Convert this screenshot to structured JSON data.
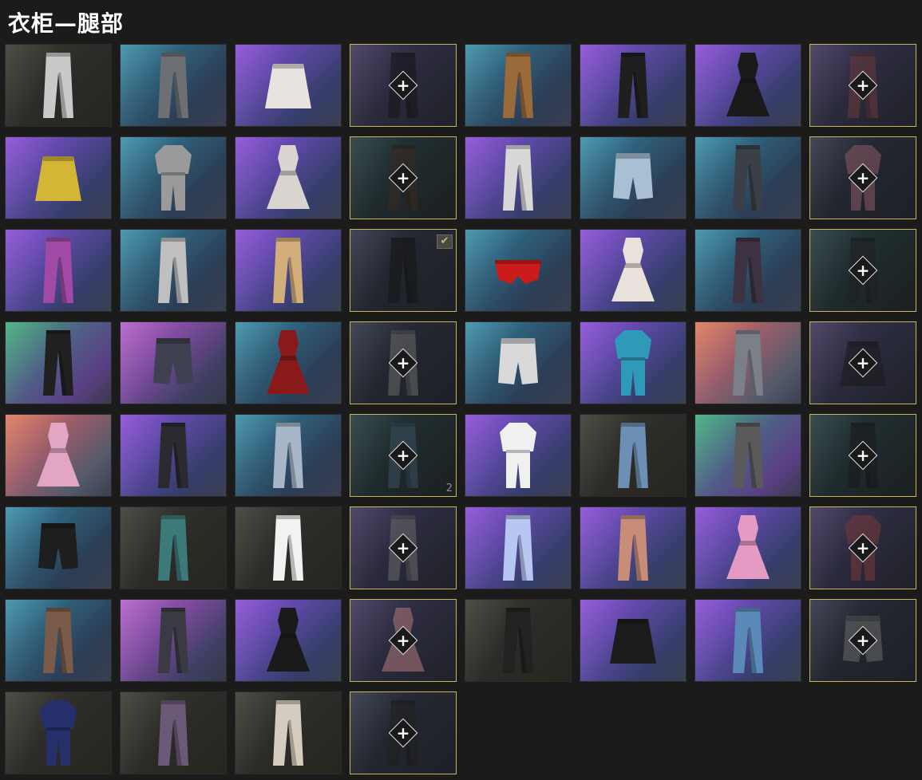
{
  "header": {
    "title": "衣柜—腿部"
  },
  "grid": {
    "cells": [
      {
        "bg": "dark",
        "kind": "pants",
        "color": "#c9c9c9"
      },
      {
        "bg": "blue",
        "kind": "pants",
        "color": "#6d6f75"
      },
      {
        "bg": "purple",
        "kind": "skirt",
        "color": "#e9e3e0"
      },
      {
        "bg": "slot violet",
        "kind": "pants",
        "color": "#151515",
        "slot": true
      },
      {
        "bg": "blue",
        "kind": "pants",
        "color": "#9a6a3a"
      },
      {
        "bg": "purple",
        "kind": "pants",
        "color": "#1f1f1f"
      },
      {
        "bg": "purple",
        "kind": "dress",
        "color": "#1a1a1a"
      },
      {
        "bg": "slot violet",
        "kind": "pants",
        "color": "#6a3a3a",
        "slot": true
      },
      {
        "bg": "purple",
        "kind": "skirt",
        "color": "#d4b637"
      },
      {
        "bg": "blue",
        "kind": "suit",
        "color": "#9a9a9a"
      },
      {
        "bg": "purple",
        "kind": "dress",
        "color": "#d9d4cf"
      },
      {
        "bg": "slot teal",
        "kind": "pants",
        "color": "#3a2a22",
        "slot": true
      },
      {
        "bg": "purple",
        "kind": "pants",
        "color": "#d8d8d8"
      },
      {
        "bg": "blue",
        "kind": "shorts",
        "color": "#a9c0d4"
      },
      {
        "bg": "blue",
        "kind": "pants",
        "color": "#3a3f48"
      },
      {
        "bg": "slot",
        "kind": "suit",
        "color": "#8a5a66",
        "slot": true
      },
      {
        "bg": "purple",
        "kind": "pants",
        "color": "#a04aa5"
      },
      {
        "bg": "blue",
        "kind": "pants",
        "color": "#bfbfbf"
      },
      {
        "bg": "purple",
        "kind": "pants",
        "color": "#d1ae7a"
      },
      {
        "bg": "slot",
        "kind": "pants",
        "color": "#151515",
        "slot": true,
        "checked": true
      },
      {
        "bg": "blue",
        "kind": "briefs",
        "color": "#cc1b1b"
      },
      {
        "bg": "purple",
        "kind": "dress",
        "color": "#e8e2da"
      },
      {
        "bg": "blue",
        "kind": "pants",
        "color": "#3c3242"
      },
      {
        "bg": "slot teal",
        "kind": "pants",
        "color": "#202020",
        "slot": true
      },
      {
        "bg": "green",
        "kind": "pants",
        "color": "#202020"
      },
      {
        "bg": "pink",
        "kind": "shorts",
        "color": "#3e4250"
      },
      {
        "bg": "blue",
        "kind": "dress",
        "color": "#8a1a1a"
      },
      {
        "bg": "slot",
        "kind": "pants",
        "color": "#6a6a6a",
        "slot": true
      },
      {
        "bg": "blue",
        "kind": "shorts",
        "color": "#d9d9d9"
      },
      {
        "bg": "purple",
        "kind": "suit",
        "color": "#2e9ab8"
      },
      {
        "bg": "orange",
        "kind": "pants",
        "color": "#7a7f88"
      },
      {
        "bg": "slot violet",
        "kind": "skirt",
        "color": "#1a1a1a",
        "slot": true
      },
      {
        "bg": "orange",
        "kind": "dress",
        "color": "#e2a6c4"
      },
      {
        "bg": "purple",
        "kind": "pants",
        "color": "#2a2a30"
      },
      {
        "bg": "blue",
        "kind": "pants",
        "color": "#a7b6c8"
      },
      {
        "bg": "slot teal",
        "kind": "pants",
        "color": "#3a5060",
        "slot": true,
        "count": "2"
      },
      {
        "bg": "purple",
        "kind": "suit",
        "color": "#f0f0f0"
      },
      {
        "bg": "dark",
        "kind": "pants",
        "color": "#6d8fb4"
      },
      {
        "bg": "green",
        "kind": "pants",
        "color": "#5a5a5a"
      },
      {
        "bg": "slot teal",
        "kind": "pants",
        "color": "#1a1a1a",
        "slot": true
      },
      {
        "bg": "blue",
        "kind": "shorts",
        "color": "#1e1e1e"
      },
      {
        "bg": "dark",
        "kind": "pants",
        "color": "#3b7a78"
      },
      {
        "bg": "dark",
        "kind": "pants",
        "color": "#f2f2f2"
      },
      {
        "bg": "slot violet",
        "kind": "pants",
        "color": "#6a6a6a",
        "slot": true
      },
      {
        "bg": "purple",
        "kind": "pants",
        "color": "#b8c6f2"
      },
      {
        "bg": "purple",
        "kind": "pants",
        "color": "#c78d79"
      },
      {
        "bg": "purple",
        "kind": "dress",
        "color": "#e49ac2"
      },
      {
        "bg": "slot violet",
        "kind": "suit",
        "color": "#7a3a3a",
        "slot": true
      },
      {
        "bg": "blue",
        "kind": "pants",
        "color": "#7a5a48"
      },
      {
        "bg": "pink",
        "kind": "pants",
        "color": "#3a3a44"
      },
      {
        "bg": "purple",
        "kind": "dress",
        "color": "#1a1a1a"
      },
      {
        "bg": "slot violet",
        "kind": "dress",
        "color": "#b07a7a",
        "slot": true
      },
      {
        "bg": "dark",
        "kind": "pants",
        "color": "#222222"
      },
      {
        "bg": "purple",
        "kind": "skirt",
        "color": "#1c1c1c"
      },
      {
        "bg": "purple",
        "kind": "pants",
        "color": "#5c8ab8"
      },
      {
        "bg": "slot",
        "kind": "shorts",
        "color": "#6a6a6a",
        "slot": true
      },
      {
        "bg": "dark",
        "kind": "suit",
        "color": "#25306a"
      },
      {
        "bg": "dark",
        "kind": "pants",
        "color": "#6a5a78"
      },
      {
        "bg": "dark",
        "kind": "pants",
        "color": "#d4cdbf"
      },
      {
        "bg": "slot",
        "kind": "pants",
        "color": "#202020",
        "slot": true
      }
    ]
  },
  "icons": {
    "add": "+",
    "check": "✔"
  }
}
